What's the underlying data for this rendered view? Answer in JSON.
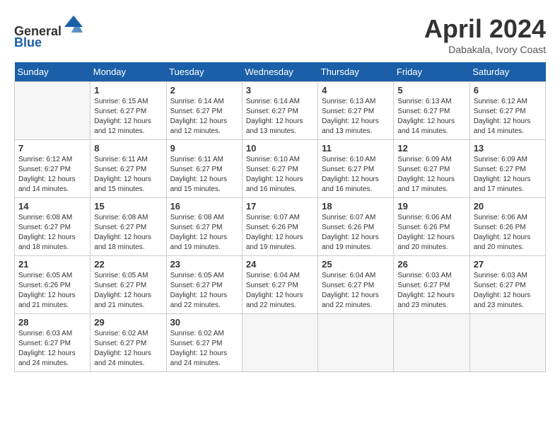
{
  "header": {
    "logo_line1": "General",
    "logo_line2": "Blue",
    "month_title": "April 2024",
    "location": "Dabakala, Ivory Coast"
  },
  "weekdays": [
    "Sunday",
    "Monday",
    "Tuesday",
    "Wednesday",
    "Thursday",
    "Friday",
    "Saturday"
  ],
  "weeks": [
    [
      {
        "day": "",
        "info": ""
      },
      {
        "day": "1",
        "info": "Sunrise: 6:15 AM\nSunset: 6:27 PM\nDaylight: 12 hours\nand 12 minutes."
      },
      {
        "day": "2",
        "info": "Sunrise: 6:14 AM\nSunset: 6:27 PM\nDaylight: 12 hours\nand 12 minutes."
      },
      {
        "day": "3",
        "info": "Sunrise: 6:14 AM\nSunset: 6:27 PM\nDaylight: 12 hours\nand 13 minutes."
      },
      {
        "day": "4",
        "info": "Sunrise: 6:13 AM\nSunset: 6:27 PM\nDaylight: 12 hours\nand 13 minutes."
      },
      {
        "day": "5",
        "info": "Sunrise: 6:13 AM\nSunset: 6:27 PM\nDaylight: 12 hours\nand 14 minutes."
      },
      {
        "day": "6",
        "info": "Sunrise: 6:12 AM\nSunset: 6:27 PM\nDaylight: 12 hours\nand 14 minutes."
      }
    ],
    [
      {
        "day": "7",
        "info": "Sunrise: 6:12 AM\nSunset: 6:27 PM\nDaylight: 12 hours\nand 14 minutes."
      },
      {
        "day": "8",
        "info": "Sunrise: 6:11 AM\nSunset: 6:27 PM\nDaylight: 12 hours\nand 15 minutes."
      },
      {
        "day": "9",
        "info": "Sunrise: 6:11 AM\nSunset: 6:27 PM\nDaylight: 12 hours\nand 15 minutes."
      },
      {
        "day": "10",
        "info": "Sunrise: 6:10 AM\nSunset: 6:27 PM\nDaylight: 12 hours\nand 16 minutes."
      },
      {
        "day": "11",
        "info": "Sunrise: 6:10 AM\nSunset: 6:27 PM\nDaylight: 12 hours\nand 16 minutes."
      },
      {
        "day": "12",
        "info": "Sunrise: 6:09 AM\nSunset: 6:27 PM\nDaylight: 12 hours\nand 17 minutes."
      },
      {
        "day": "13",
        "info": "Sunrise: 6:09 AM\nSunset: 6:27 PM\nDaylight: 12 hours\nand 17 minutes."
      }
    ],
    [
      {
        "day": "14",
        "info": "Sunrise: 6:08 AM\nSunset: 6:27 PM\nDaylight: 12 hours\nand 18 minutes."
      },
      {
        "day": "15",
        "info": "Sunrise: 6:08 AM\nSunset: 6:27 PM\nDaylight: 12 hours\nand 18 minutes."
      },
      {
        "day": "16",
        "info": "Sunrise: 6:08 AM\nSunset: 6:27 PM\nDaylight: 12 hours\nand 19 minutes."
      },
      {
        "day": "17",
        "info": "Sunrise: 6:07 AM\nSunset: 6:26 PM\nDaylight: 12 hours\nand 19 minutes."
      },
      {
        "day": "18",
        "info": "Sunrise: 6:07 AM\nSunset: 6:26 PM\nDaylight: 12 hours\nand 19 minutes."
      },
      {
        "day": "19",
        "info": "Sunrise: 6:06 AM\nSunset: 6:26 PM\nDaylight: 12 hours\nand 20 minutes."
      },
      {
        "day": "20",
        "info": "Sunrise: 6:06 AM\nSunset: 6:26 PM\nDaylight: 12 hours\nand 20 minutes."
      }
    ],
    [
      {
        "day": "21",
        "info": "Sunrise: 6:05 AM\nSunset: 6:26 PM\nDaylight: 12 hours\nand 21 minutes."
      },
      {
        "day": "22",
        "info": "Sunrise: 6:05 AM\nSunset: 6:27 PM\nDaylight: 12 hours\nand 21 minutes."
      },
      {
        "day": "23",
        "info": "Sunrise: 6:05 AM\nSunset: 6:27 PM\nDaylight: 12 hours\nand 22 minutes."
      },
      {
        "day": "24",
        "info": "Sunrise: 6:04 AM\nSunset: 6:27 PM\nDaylight: 12 hours\nand 22 minutes."
      },
      {
        "day": "25",
        "info": "Sunrise: 6:04 AM\nSunset: 6:27 PM\nDaylight: 12 hours\nand 22 minutes."
      },
      {
        "day": "26",
        "info": "Sunrise: 6:03 AM\nSunset: 6:27 PM\nDaylight: 12 hours\nand 23 minutes."
      },
      {
        "day": "27",
        "info": "Sunrise: 6:03 AM\nSunset: 6:27 PM\nDaylight: 12 hours\nand 23 minutes."
      }
    ],
    [
      {
        "day": "28",
        "info": "Sunrise: 6:03 AM\nSunset: 6:27 PM\nDaylight: 12 hours\nand 24 minutes."
      },
      {
        "day": "29",
        "info": "Sunrise: 6:02 AM\nSunset: 6:27 PM\nDaylight: 12 hours\nand 24 minutes."
      },
      {
        "day": "30",
        "info": "Sunrise: 6:02 AM\nSunset: 6:27 PM\nDaylight: 12 hours\nand 24 minutes."
      },
      {
        "day": "",
        "info": ""
      },
      {
        "day": "",
        "info": ""
      },
      {
        "day": "",
        "info": ""
      },
      {
        "day": "",
        "info": ""
      }
    ]
  ]
}
